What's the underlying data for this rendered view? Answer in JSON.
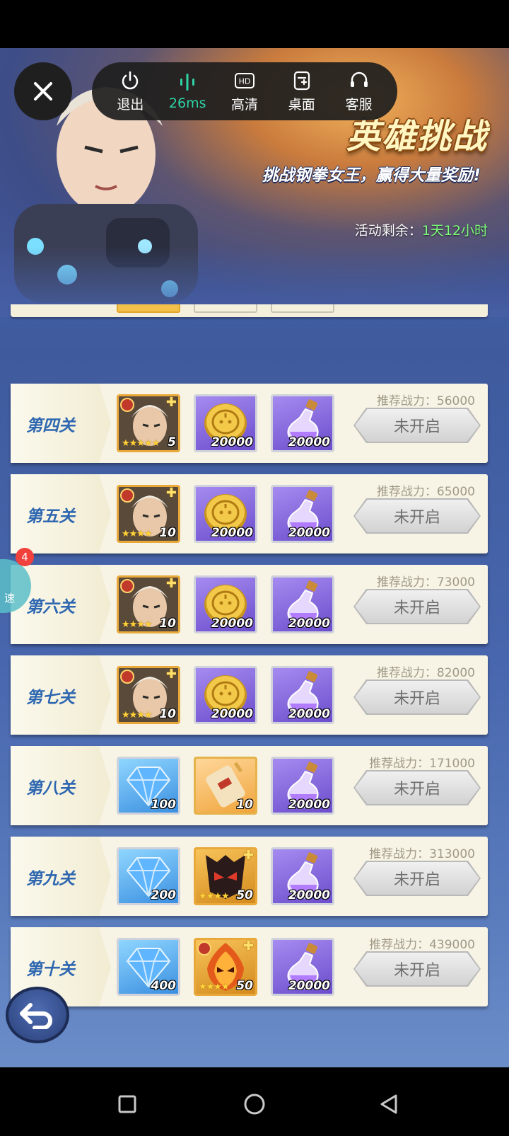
{
  "toolbar": {
    "close_icon": "close-icon",
    "items": [
      {
        "label": "退出",
        "icon": "power-icon"
      },
      {
        "label": "26ms",
        "icon": "signal-icon"
      },
      {
        "label": "高清",
        "icon": "hd-icon",
        "icon_text": "HD"
      },
      {
        "label": "桌面",
        "icon": "desktop-shortcut-icon"
      },
      {
        "label": "客服",
        "icon": "headset-icon"
      }
    ],
    "active_color": "#2fd4a6"
  },
  "banner": {
    "title": "英雄挑战",
    "subtitle": "挑战钢拳女王，赢得大量奖励!",
    "time_label": "活动剩余：",
    "time_value": "1天12小时"
  },
  "stages": [
    {
      "name": "第四关",
      "power": "推荐战力：56000",
      "button": "未开启",
      "rewards": [
        {
          "type": "hero",
          "qty": "5",
          "stars": "★★★★★"
        },
        {
          "type": "coin",
          "qty": "20000"
        },
        {
          "type": "potion",
          "qty": "20000"
        }
      ]
    },
    {
      "name": "第五关",
      "power": "推荐战力：65000",
      "button": "未开启",
      "rewards": [
        {
          "type": "hero",
          "qty": "10",
          "stars": "★★★★"
        },
        {
          "type": "coin",
          "qty": "20000"
        },
        {
          "type": "potion",
          "qty": "20000"
        }
      ]
    },
    {
      "name": "第六关",
      "power": "推荐战力：73000",
      "button": "未开启",
      "rewards": [
        {
          "type": "hero",
          "qty": "10",
          "stars": "★★★★"
        },
        {
          "type": "coin",
          "qty": "20000"
        },
        {
          "type": "potion",
          "qty": "20000"
        }
      ]
    },
    {
      "name": "第七关",
      "power": "推荐战力：82000",
      "button": "未开启",
      "rewards": [
        {
          "type": "hero",
          "qty": "10",
          "stars": "★★★★"
        },
        {
          "type": "coin",
          "qty": "20000"
        },
        {
          "type": "potion",
          "qty": "20000"
        }
      ]
    },
    {
      "name": "第八关",
      "power": "推荐战力：171000",
      "button": "未开启",
      "rewards": [
        {
          "type": "diamond",
          "qty": "100"
        },
        {
          "type": "scroll",
          "qty": "10"
        },
        {
          "type": "potion",
          "qty": "20000"
        }
      ]
    },
    {
      "name": "第九关",
      "power": "推荐战力：313000",
      "button": "未开启",
      "rewards": [
        {
          "type": "diamond",
          "qty": "200"
        },
        {
          "type": "mask",
          "qty": "50",
          "stars": "★★★★"
        },
        {
          "type": "potion",
          "qty": "20000"
        }
      ]
    },
    {
      "name": "第十关",
      "power": "推荐战力：439000",
      "button": "未开启",
      "rewards": [
        {
          "type": "diamond",
          "qty": "400"
        },
        {
          "type": "fire-mask",
          "qty": "50",
          "stars": "★★★★"
        },
        {
          "type": "potion",
          "qty": "20000"
        }
      ]
    }
  ],
  "side_widget": {
    "badge": "4",
    "text": "速"
  },
  "nav": {
    "recent": "recent-apps-icon",
    "home": "home-icon",
    "back": "back-icon"
  }
}
